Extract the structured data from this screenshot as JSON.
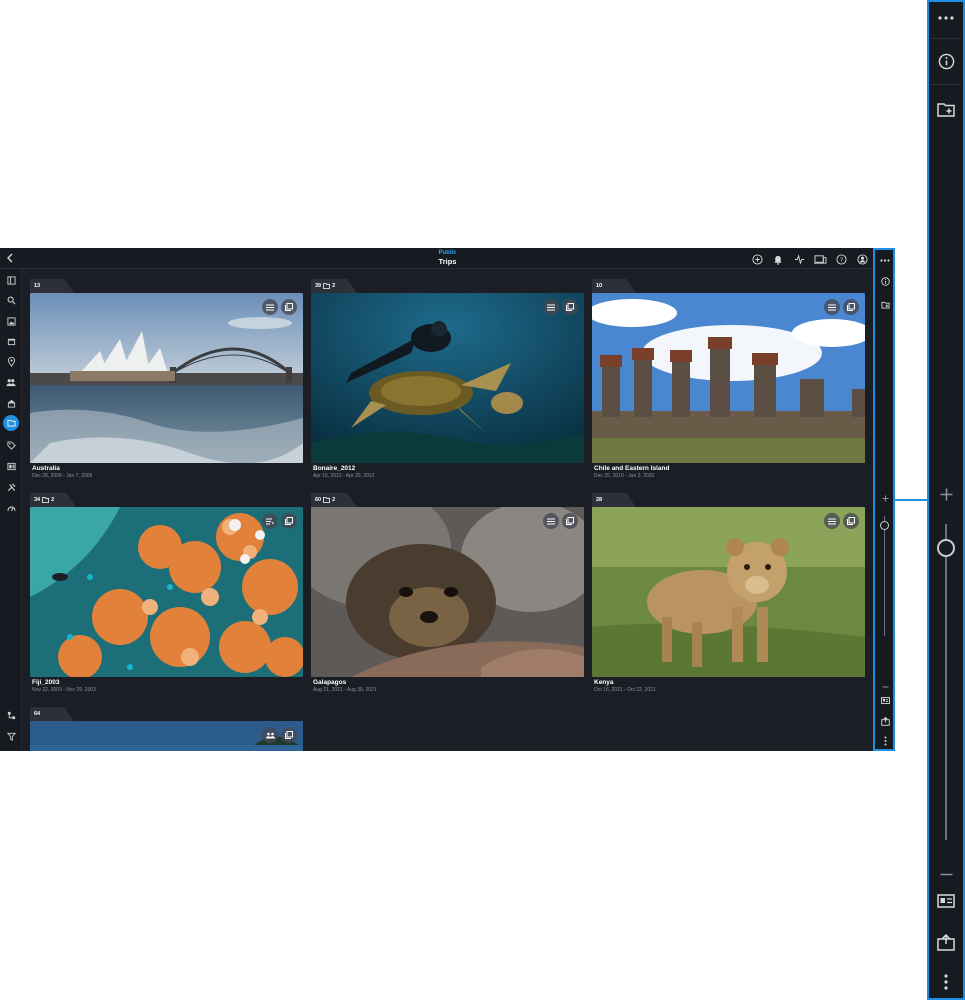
{
  "header": {
    "subtitle": "Public",
    "title": "Trips",
    "icons": [
      "add-circle-icon",
      "bell-icon",
      "activity-icon",
      "devices-icon",
      "help-icon",
      "account-icon"
    ]
  },
  "left_nav": {
    "icons": [
      "layout-icon",
      "search-icon",
      "photo-icon",
      "calendar-icon",
      "location-icon",
      "people-icon",
      "museum-icon",
      "folder-icon",
      "tags-icon",
      "slideshow-icon",
      "tools-icon",
      "dashboard-icon",
      "flowchart-icon",
      "filter-icon"
    ],
    "active": "folder-icon"
  },
  "albums": [
    {
      "count": "13",
      "folder_count": "",
      "title": "Australia",
      "dates": "Dec 28, 2008 - Jan 7, 2009",
      "scene": "sydney"
    },
    {
      "count": "39",
      "folder_count": "2",
      "title": "Bonaire_2012",
      "dates": "Apr 15, 2012 - Apr 20, 2012",
      "scene": "turtle"
    },
    {
      "count": "10",
      "folder_count": "",
      "title": "Chile and Eastern Island",
      "dates": "Dec 25, 2019 - Jan 2, 2020",
      "scene": "moai"
    },
    {
      "count": "34",
      "folder_count": "2",
      "title": "Fiji_2003",
      "dates": "Nov 22, 2003 - Nov 29, 2003",
      "scene": "coral"
    },
    {
      "count": "60",
      "folder_count": "2",
      "title": "Galapagos",
      "dates": "Aug 21, 2021 - Aug 30, 2021",
      "scene": "sealion"
    },
    {
      "count": "28",
      "folder_count": "",
      "title": "Kenya",
      "dates": "Oct 16, 2021 - Oct 22, 2021",
      "scene": "lion"
    },
    {
      "count": "64",
      "folder_count": "",
      "title": "",
      "dates": "",
      "scene": "sky"
    }
  ],
  "right_rail": {
    "icons": [
      "more-horizontal-icon",
      "info-icon",
      "add-folder-icon",
      "zoom-in-icon",
      "zoom-slider",
      "zoom-out-icon",
      "id-card-icon",
      "share-icon",
      "more-vertical-icon"
    ]
  },
  "colors": {
    "accent": "#1e8ee0",
    "background": "#1c1e26",
    "panel": "#181a21"
  }
}
